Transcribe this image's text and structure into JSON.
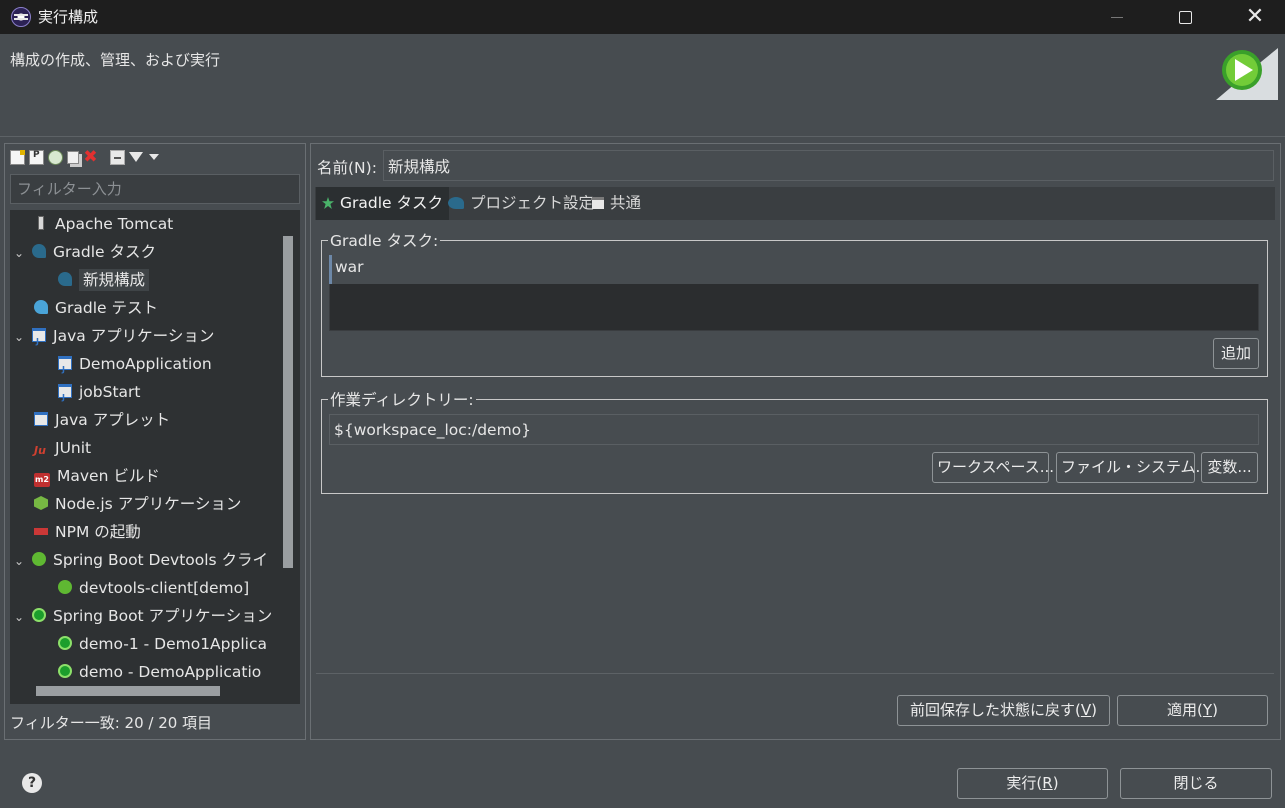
{
  "window": {
    "title": "実行構成"
  },
  "header": {
    "description": "構成の作成、管理、および実行"
  },
  "left": {
    "filter_placeholder": "フィルター入力",
    "filter_status": "フィルター一致: 20 / 20 項目",
    "toolbar_icons": [
      "new-config-icon",
      "new-prototype-icon",
      "duplicate-icon",
      "copy-icon",
      "delete-icon",
      "collapse-all-icon",
      "filter-icon",
      "view-menu-icon"
    ],
    "tree": [
      {
        "label": "Apache Tomcat",
        "icon": "tomcat-icon"
      },
      {
        "label": "Gradle タスク",
        "icon": "gradle-icon",
        "expanded": true
      },
      {
        "label": "新規構成",
        "icon": "gradle-icon",
        "selected": true
      },
      {
        "label": "Gradle テスト",
        "icon": "gradle-test-icon"
      },
      {
        "label": "Java アプリケーション",
        "icon": "java-app-icon",
        "expanded": true
      },
      {
        "label": "DemoApplication",
        "icon": "java-app-icon"
      },
      {
        "label": "jobStart",
        "icon": "java-app-icon"
      },
      {
        "label": "Java アプレット",
        "icon": "java-applet-icon"
      },
      {
        "label": "JUnit",
        "icon": "junit-icon"
      },
      {
        "label": "Maven ビルド",
        "icon": "maven-icon"
      },
      {
        "label": "Node.js アプリケーション",
        "icon": "nodejs-icon"
      },
      {
        "label": "NPM の起動",
        "icon": "npm-icon"
      },
      {
        "label": "Spring Boot Devtools クライ",
        "icon": "spring-devtools-icon",
        "expanded": true
      },
      {
        "label": "devtools-client[demo]",
        "icon": "spring-devtools-icon"
      },
      {
        "label": "Spring Boot アプリケーション",
        "icon": "spring-boot-icon",
        "expanded": true
      },
      {
        "label": "demo-1 - Demo1Applica",
        "icon": "spring-boot-icon"
      },
      {
        "label": "demo - DemoApplicatio",
        "icon": "spring-boot-icon"
      }
    ]
  },
  "right": {
    "name_label": "名前(N):",
    "name_value": "新規構成",
    "tabs": [
      {
        "label": "Gradle タスク",
        "icon": "gradle-task-icon",
        "active": true
      },
      {
        "label": "プロジェクト設定",
        "icon": "gradle-icon"
      },
      {
        "label": "共通",
        "icon": "common-icon"
      }
    ],
    "tasks_group": {
      "legend": "Gradle タスク:",
      "tasks": "war",
      "add_button": "追加"
    },
    "workdir_group": {
      "legend": "作業ディレクトリー:",
      "value": "${workspace_loc:/demo}",
      "workspace_button": "ワークスペース...",
      "filesystem_button": "ファイル・システム...",
      "variables_button": "変数..."
    },
    "revert_button": {
      "text": "前回保存した状態に戻す(",
      "mnemonic": "V",
      "end": ")"
    },
    "apply_button": {
      "text": "適用(",
      "mnemonic": "Y",
      "end": ")"
    }
  },
  "footer": {
    "help_icon": "?",
    "run_button": {
      "text": "実行(",
      "mnemonic": "R",
      "end": ")"
    },
    "close_button": "閉じる"
  }
}
